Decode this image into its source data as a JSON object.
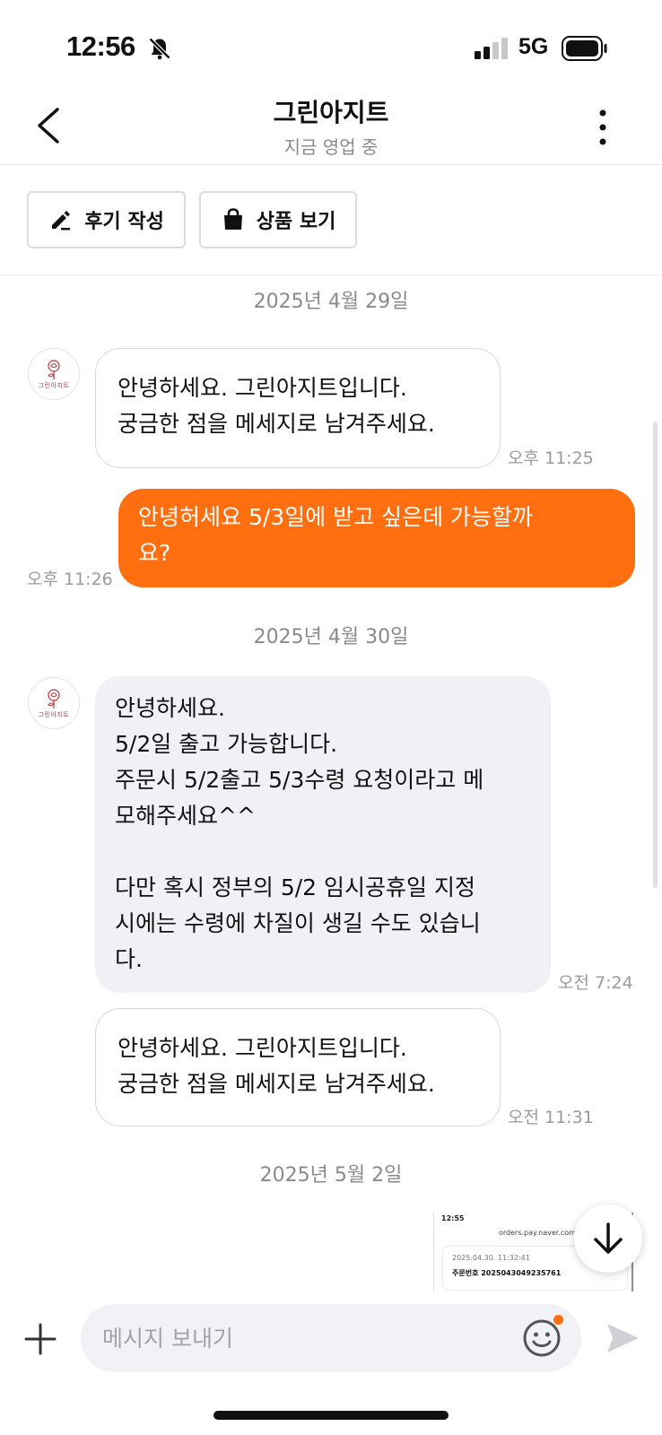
{
  "status_bar": {
    "time": "12:56",
    "network": "5G"
  },
  "header": {
    "title": "그린아지트",
    "subtitle": "지금 영업 중"
  },
  "actions": {
    "review_label": "후기 작성",
    "products_label": "상품 보기"
  },
  "avatar_text": "그린아지트",
  "chat": {
    "date1": "2025년 4월 29일",
    "msg1": "안녕하세요. 그린아지트입니다.\n궁금한 점을 메세지로 남겨주세요.",
    "msg1_time": "오후 11:25",
    "msg2": "안녕허세요 5/3일에 받고 싶은데 가능할까\n요?",
    "msg2_time": "오후 11:26",
    "date2": "2025년 4월 30일",
    "msg3": "안녕하세요.\n5/2일 출고 가능합니다.\n주문시 5/2출고 5/3수령 요청이라고 메\n모해주세요^^\n\n다만 혹시 정부의 5/2 임시공휴일 지정\n시에는 수령에 차질이 생길 수도 있습니\n다.",
    "msg3_time": "오전 7:24",
    "msg4": "안녕하세요. 그린아지트입니다.\n궁금한 점을 메세지로 남겨주세요.",
    "msg4_time": "오전 11:31",
    "date3": "2025년 5월 2일"
  },
  "image_preview": {
    "top_text": "12:55",
    "url": "orders.pay.naver.com",
    "date": "2025.04.30. 11:32:41",
    "order": "주문번호 2025043049235761"
  },
  "input": {
    "placeholder": "메시지 보내기",
    "value": ""
  },
  "colors": {
    "accent": "#ff6f0f",
    "bubble_grey": "#f0f1f5",
    "muted": "#8a8a8a"
  }
}
